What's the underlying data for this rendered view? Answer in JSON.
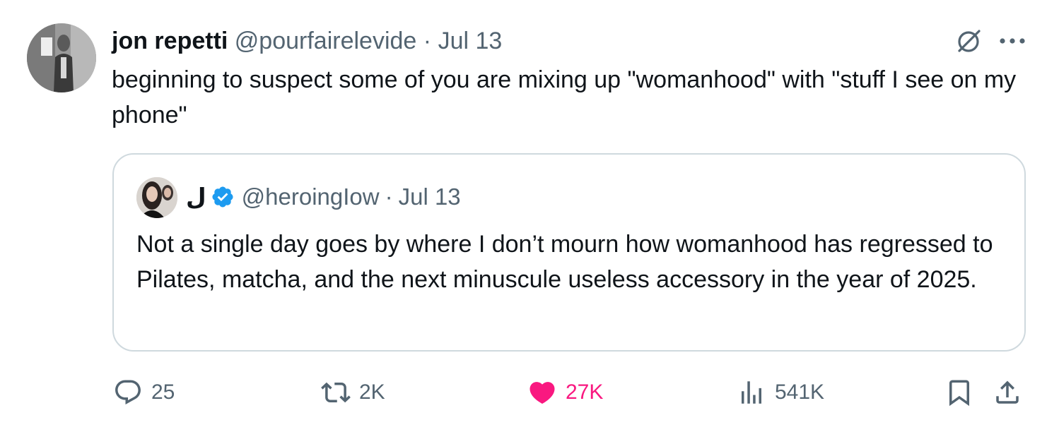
{
  "tweet": {
    "author": {
      "name": "jon repetti",
      "handle": "@pourfairelevide",
      "separator": "·",
      "date": "Jul 13"
    },
    "text": "beginning to suspect some of you are mixing up \"womanhood\" with \"stuff I see on my phone\"",
    "top_icons": [
      "grok-icon",
      "more-icon"
    ],
    "quote": {
      "name": "ل",
      "verified": true,
      "handle": "@heroingIow",
      "separator": "·",
      "date": "Jul 13",
      "text": "Not a single day goes by where I don’t mourn how womanhood has regressed to Pilates, matcha, and the next minuscule useless accessory in the year of 2025."
    },
    "actions": {
      "replies": "25",
      "reposts": "2K",
      "likes": "27K",
      "views": "541K"
    }
  },
  "colors": {
    "text": "#0f1419",
    "secondary": "#536471",
    "border": "#cfd9de",
    "like": "#f91880",
    "verified": "#1d9bf0"
  }
}
